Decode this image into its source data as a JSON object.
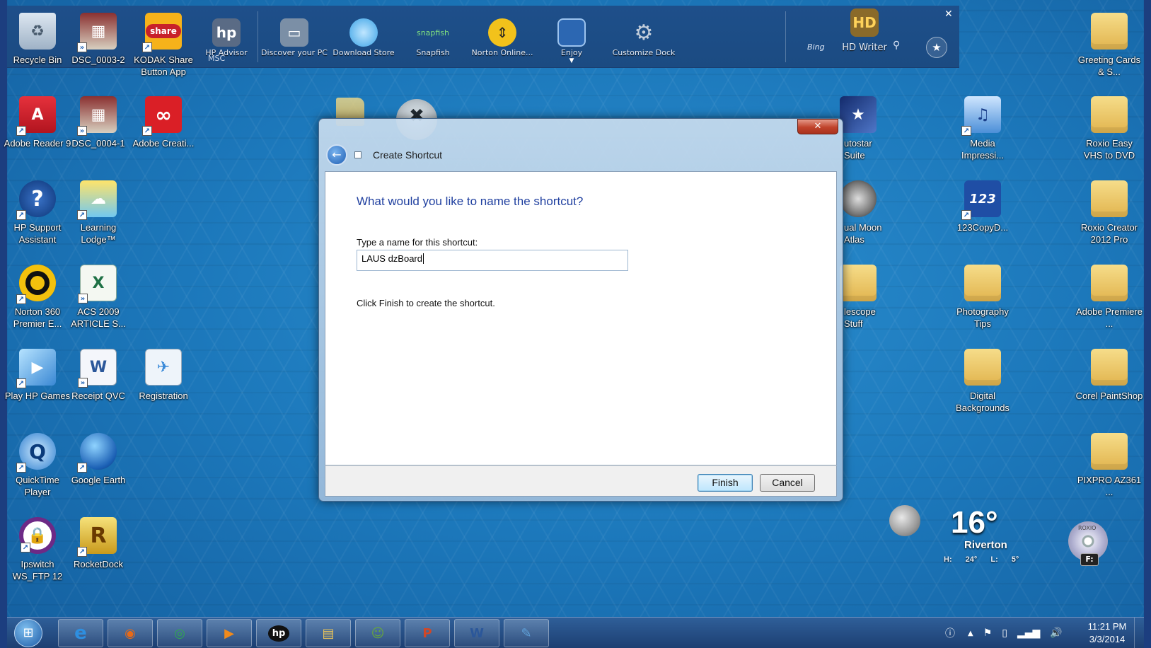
{
  "dock": {
    "items": [
      {
        "label": "HP Advisor",
        "icon": "hp-advisor-icon",
        "color": "#5a6b85"
      },
      {
        "label": "Discover your PC",
        "icon": "discover-pc-icon",
        "color": "#7b8fa6"
      },
      {
        "label": "Download Store",
        "icon": "download-store-icon",
        "color": "#3aa2e6"
      },
      {
        "label": "Snapfish",
        "icon": "snapfish-icon",
        "color": "#2b6cb5"
      },
      {
        "label": "Norton Online...",
        "icon": "norton-online-icon",
        "color": "#f2c21b"
      },
      {
        "label": "Enjoy",
        "icon": "enjoy-tv-icon",
        "color": "#2c67b2"
      },
      {
        "label": "Customize Dock",
        "icon": "gear-icon",
        "color": "#8c9bb0"
      }
    ],
    "bing_label": "Bing",
    "hd_writer_label": "HD Writer",
    "msc_label": "MSC"
  },
  "desktop_icons": {
    "col1": [
      {
        "label": "Recycle Bin",
        "icon": "recycle-bin-icon",
        "glyph": "🗑"
      },
      {
        "label": "Adobe Reader 9",
        "icon": "adobe-reader-icon",
        "glyph": "A"
      },
      {
        "label": "HP Support Assistant",
        "icon": "hp-support-icon",
        "glyph": "?"
      },
      {
        "label": "Norton 360 Premier E...",
        "icon": "norton-360-icon",
        "glyph": "O"
      },
      {
        "label": "Play HP Games",
        "icon": "hp-games-icon",
        "glyph": "▶"
      },
      {
        "label": "QuickTime Player",
        "icon": "quicktime-icon",
        "glyph": "Q"
      },
      {
        "label": "Ipswitch WS_FTP 12",
        "icon": "ipswitch-ftp-icon",
        "glyph": "🔒"
      }
    ],
    "col2": [
      {
        "label": "DSC_0003-2",
        "icon": "photo-icon",
        "glyph": "▦"
      },
      {
        "label": "DSC_0004-1",
        "icon": "photo-icon",
        "glyph": "▦"
      },
      {
        "label": "Learning Lodge™",
        "icon": "learning-lodge-icon",
        "glyph": "☁"
      },
      {
        "label": "ACS 2009 ARTICLE S...",
        "icon": "excel-file-icon",
        "glyph": "X"
      },
      {
        "label": "Receipt QVC",
        "icon": "word-file-icon",
        "glyph": "W"
      },
      {
        "label": "Google Earth",
        "icon": "google-earth-icon",
        "glyph": "◍"
      },
      {
        "label": "RocketDock",
        "icon": "rocketdock-icon",
        "glyph": "R"
      }
    ],
    "col3": [
      {
        "label": "KODAK Share Button App",
        "icon": "kodak-share-icon",
        "glyph": "share"
      },
      {
        "label": "Adobe Creati...",
        "icon": "adobe-creative-cloud-icon",
        "glyph": "∞"
      },
      {
        "label": "Registration",
        "icon": "registration-icon",
        "glyph": "✈"
      }
    ],
    "partial_col": [
      {
        "label": "utostar Suite",
        "icon": "autostar-icon",
        "glyph": "★"
      },
      {
        "label": "ual Moon Atlas",
        "icon": "moon-atlas-icon",
        "glyph": "●"
      },
      {
        "label": "lescope Stuff",
        "icon": "folder-icon",
        "glyph": ""
      }
    ],
    "col_right1": [
      {
        "label": "Media Impressi...",
        "icon": "media-impression-icon",
        "glyph": "♫"
      },
      {
        "label": "123CopyD...",
        "icon": "123copydvd-icon",
        "glyph": "123"
      },
      {
        "label": "Photography Tips",
        "icon": "folder-icon",
        "glyph": ""
      },
      {
        "label": "Digital Backgrounds",
        "icon": "folder-icon",
        "glyph": ""
      }
    ],
    "col_right2": [
      {
        "label": "Greeting Cards & S...",
        "icon": "folder-icon",
        "glyph": ""
      },
      {
        "label": "Roxio Easy VHS to DVD",
        "icon": "folder-icon",
        "glyph": ""
      },
      {
        "label": "Roxio Creator 2012 Pro",
        "icon": "folder-icon",
        "glyph": ""
      },
      {
        "label": "Adobe Premiere ...",
        "icon": "folder-icon",
        "glyph": ""
      },
      {
        "label": "Corel PaintShop",
        "icon": "folder-icon",
        "glyph": ""
      },
      {
        "label": "PIXPRO AZ361 ...",
        "icon": "folder-icon",
        "glyph": ""
      }
    ]
  },
  "dialog": {
    "title": "Create Shortcut",
    "close_glyph": "✕",
    "heading": "What would you like to name the shortcut?",
    "name_label": "Type a name for this shortcut:",
    "name_value": "LAUS dzBoard",
    "hint": "Click Finish to create the shortcut.",
    "finish_label": "Finish",
    "cancel_label": "Cancel"
  },
  "weather": {
    "temp": "16°",
    "city": "Riverton",
    "high_low": "H: 24° L: 5°"
  },
  "drive": {
    "letter": "F:",
    "brand": "ROXIO"
  },
  "taskbar": {
    "apps": [
      {
        "name": "internet-explorer-icon",
        "glyph": "e",
        "color": "#2e8fe0"
      },
      {
        "name": "firefox-icon",
        "glyph": "◉",
        "color": "#e86a17"
      },
      {
        "name": "chrome-icon",
        "glyph": "◎",
        "color": "#2fa84f"
      },
      {
        "name": "media-player-icon",
        "glyph": "▶",
        "color": "#f08a1c"
      },
      {
        "name": "hp-icon",
        "glyph": "hp",
        "color": "#1b1b1b"
      },
      {
        "name": "file-explorer-icon",
        "glyph": "▤",
        "color": "#e8c35a"
      },
      {
        "name": "people-icon",
        "glyph": "☺",
        "color": "#67a83b"
      },
      {
        "name": "powerpoint-icon",
        "glyph": "P",
        "color": "#d24726"
      },
      {
        "name": "word-icon",
        "glyph": "W",
        "color": "#2b579a"
      },
      {
        "name": "paint-icon",
        "glyph": "✎",
        "color": "#5fa0d8"
      }
    ],
    "time": "11:21 PM",
    "date": "3/3/2014"
  }
}
